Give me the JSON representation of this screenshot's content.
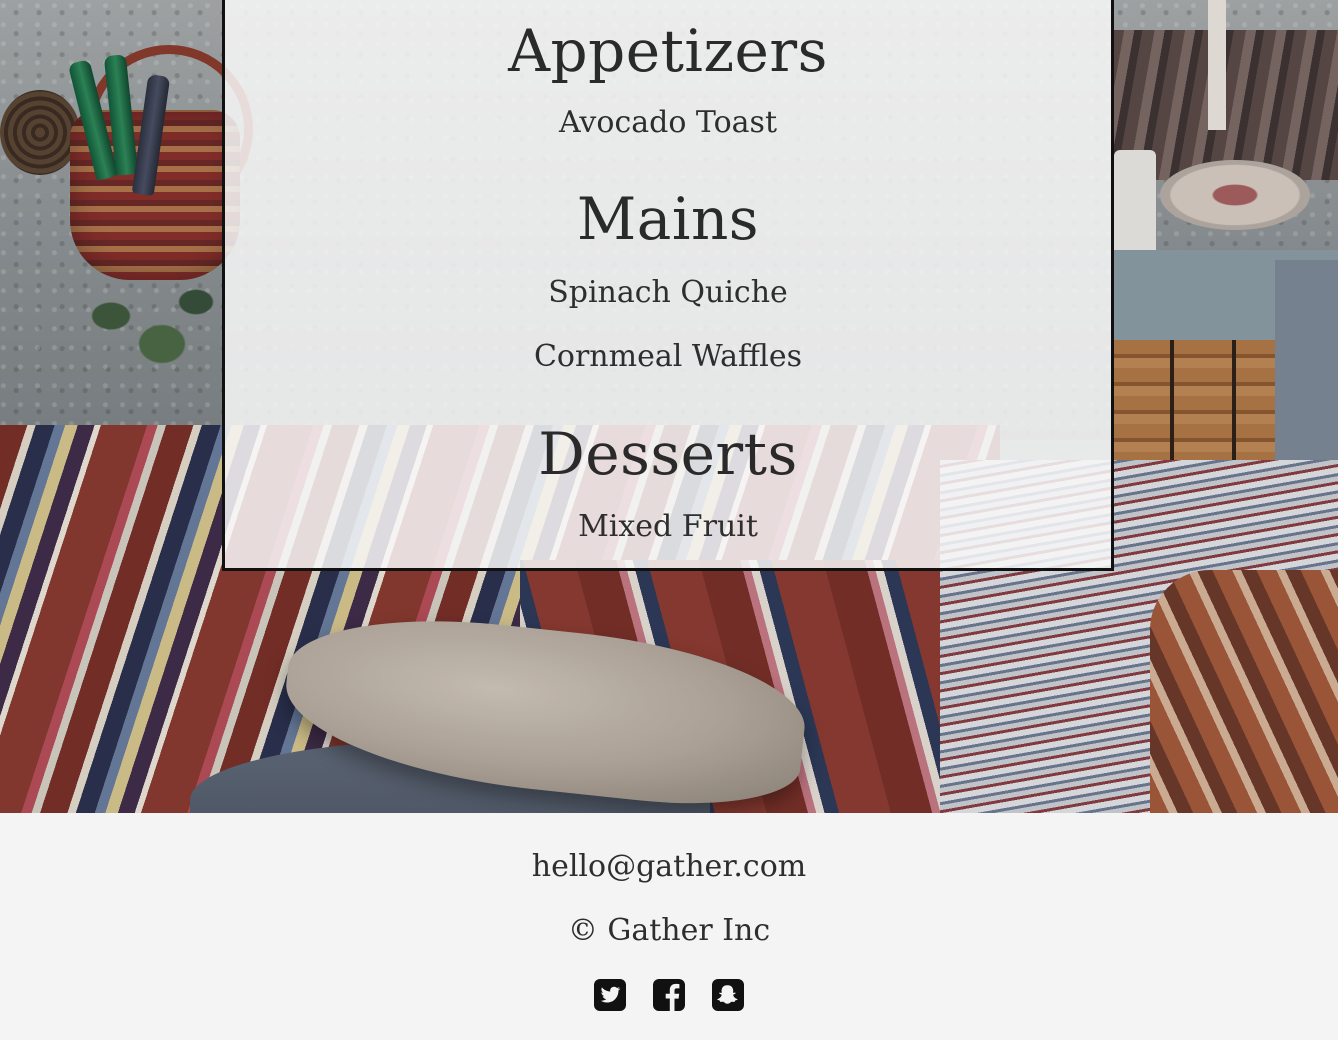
{
  "menu": {
    "sections": [
      {
        "heading": "Appetizers",
        "items": [
          "Avocado Toast"
        ]
      },
      {
        "heading": "Mains",
        "items": [
          "Spinach Quiche",
          "Cornmeal Waffles"
        ]
      },
      {
        "heading": "Desserts",
        "items": [
          "Mixed Fruit"
        ]
      }
    ]
  },
  "footer": {
    "email": "hello@gather.com",
    "copyright": "© Gather Inc",
    "social": [
      {
        "icon": "twitter-icon"
      },
      {
        "icon": "facebook-icon"
      },
      {
        "icon": "snapchat-icon"
      }
    ]
  },
  "colors": {
    "text": "#2a2a2a",
    "card_border": "#111111",
    "footer_bg": "#f4f4f4",
    "icon": "#111111"
  }
}
